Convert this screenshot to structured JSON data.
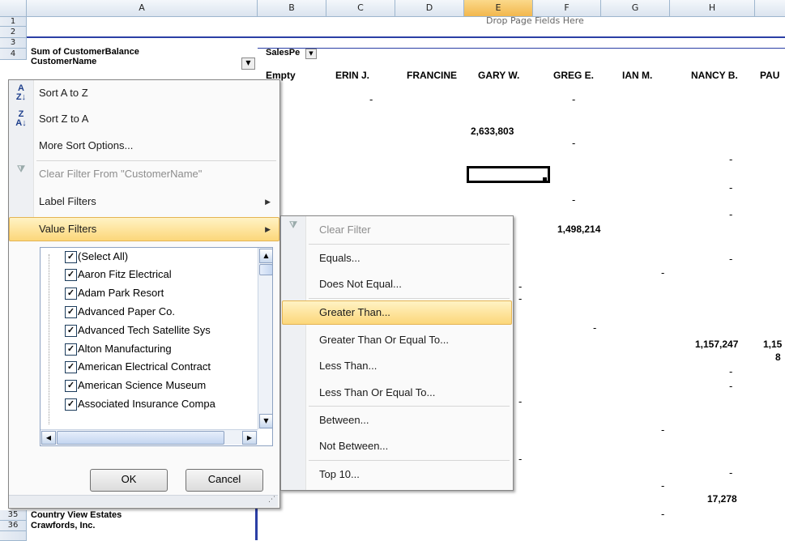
{
  "grid": {
    "columns": [
      "A",
      "B",
      "C",
      "D",
      "E",
      "F",
      "G",
      "H"
    ],
    "drop_page_fields": "Drop Page Fields Here",
    "row_numbers": [
      "1",
      "2",
      "3",
      "4"
    ],
    "bottom_rows": [
      {
        "num": "35",
        "label": "Country View Estates"
      },
      {
        "num": "36",
        "label": "Crawfords, Inc."
      }
    ],
    "a3": "Sum of CustomerBalance",
    "a4": "CustomerName",
    "b3": "SalesPe",
    "headers": [
      "Empty",
      "ERIN J.",
      "FRANCINE",
      "GARY W.",
      "GREG E.",
      "IAN M.",
      "NANCY B.",
      "PAU"
    ],
    "values": [
      "2,633,803",
      "1,498,214",
      "1,157,247",
      "1,15",
      "8",
      "17,278"
    ]
  },
  "sort_menu": {
    "items": [
      {
        "label": "Sort A to Z",
        "icon": "sort-az-icon"
      },
      {
        "label": "Sort Z to A",
        "icon": "sort-za-icon"
      },
      {
        "label": "More Sort Options..."
      },
      {
        "label": "Clear Filter From \"CustomerName\"",
        "icon": "clear-filter-icon"
      },
      {
        "label": "Label Filters"
      },
      {
        "label": "Value Filters"
      }
    ],
    "list": [
      "(Select All)",
      "Aaron Fitz Electrical",
      "Adam Park Resort",
      "Advanced Paper Co.",
      "Advanced Tech Satellite Sys",
      "Alton Manufacturing",
      "American Electrical Contract",
      "American Science Museum",
      "Associated Insurance Compa"
    ],
    "ok_label": "OK",
    "cancel_label": "Cancel"
  },
  "value_filters_menu": {
    "items": [
      "Clear Filter",
      "Equals...",
      "Does Not Equal...",
      "Greater Than...",
      "Greater Than Or Equal To...",
      "Less Than...",
      "Less Than Or Equal To...",
      "Between...",
      "Not Between...",
      "Top 10..."
    ]
  },
  "colors": {
    "highlight": "#fcd77a",
    "header_border": "#9eb6ce",
    "pivot_border": "#2b3fa5"
  }
}
